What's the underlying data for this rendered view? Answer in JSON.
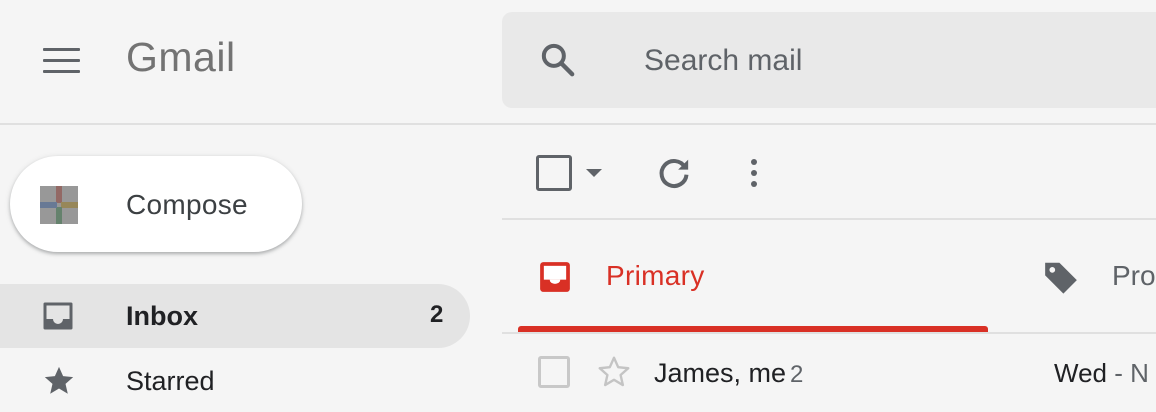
{
  "header": {
    "logo_text": "Gmail",
    "search_placeholder": "Search mail"
  },
  "sidebar": {
    "compose_label": "Compose",
    "items": [
      {
        "label": "Inbox",
        "count": "2",
        "icon": "inbox-icon",
        "selected": true
      },
      {
        "label": "Starred",
        "icon": "star-icon",
        "selected": false
      }
    ]
  },
  "toolbar": {
    "icons": [
      "checkbox-icon",
      "chevron-down-icon",
      "refresh-icon",
      "more-vert-icon"
    ]
  },
  "tabs": [
    {
      "label": "Primary",
      "icon": "inbox-tab-icon",
      "active": true,
      "color": "#d93025"
    },
    {
      "label": "Pro",
      "icon": "tag-icon",
      "active": false
    }
  ],
  "emails": [
    {
      "sender": "James, me",
      "thread_count": "2",
      "date": "Wed",
      "separator": "-",
      "snippet_start": "N"
    }
  ],
  "colors": {
    "background": "#f5f5f5",
    "accent": "#d93025",
    "selected_nav": "#e4e4e4",
    "icon_gray": "#5f6368"
  }
}
